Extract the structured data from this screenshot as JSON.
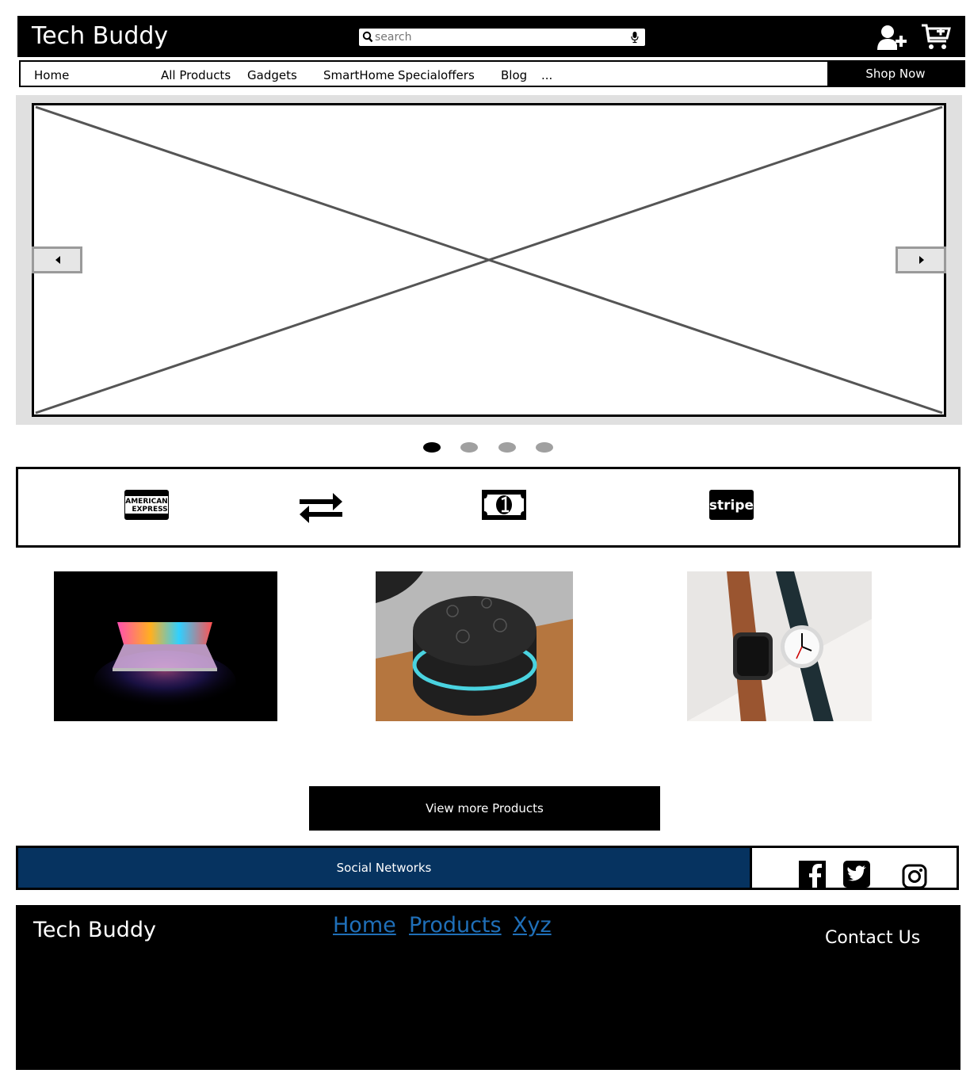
{
  "header": {
    "brand": "Tech Buddy",
    "search_placeholder": "search",
    "icons": [
      "search-icon",
      "mic-icon",
      "add-user-icon",
      "cart-icon"
    ]
  },
  "nav": {
    "items": [
      "Home",
      "All Products",
      "Gadgets",
      "SmartHome",
      "Specialoffers",
      "Blog",
      "..."
    ],
    "shop_now": "Shop Now"
  },
  "carousel": {
    "slides": 4,
    "active_slide": 1
  },
  "payments": {
    "icons": [
      "amex-icon",
      "transfer-icon",
      "cash-icon",
      "stripe-icon"
    ],
    "amex_line1": "AMERICAN",
    "amex_line2": "EXPRESS",
    "stripe_text": "stripe"
  },
  "products": [
    {
      "name": "laptop-image"
    },
    {
      "name": "smart-speaker-image"
    },
    {
      "name": "watches-image"
    }
  ],
  "view_more": "View more Products",
  "social": {
    "label": "Social Networks",
    "icons": [
      "facebook-icon",
      "twitter-icon",
      "instagram-icon"
    ]
  },
  "footer": {
    "brand": "Tech Buddy",
    "links": [
      "Home",
      "Products",
      "Xyz"
    ],
    "contact": "Contact Us"
  },
  "colors": {
    "header_bg": "#000000",
    "social_bar": "#063360",
    "footer_link": "#1f6fb8",
    "dot_inactive": "#a0a0a0"
  }
}
